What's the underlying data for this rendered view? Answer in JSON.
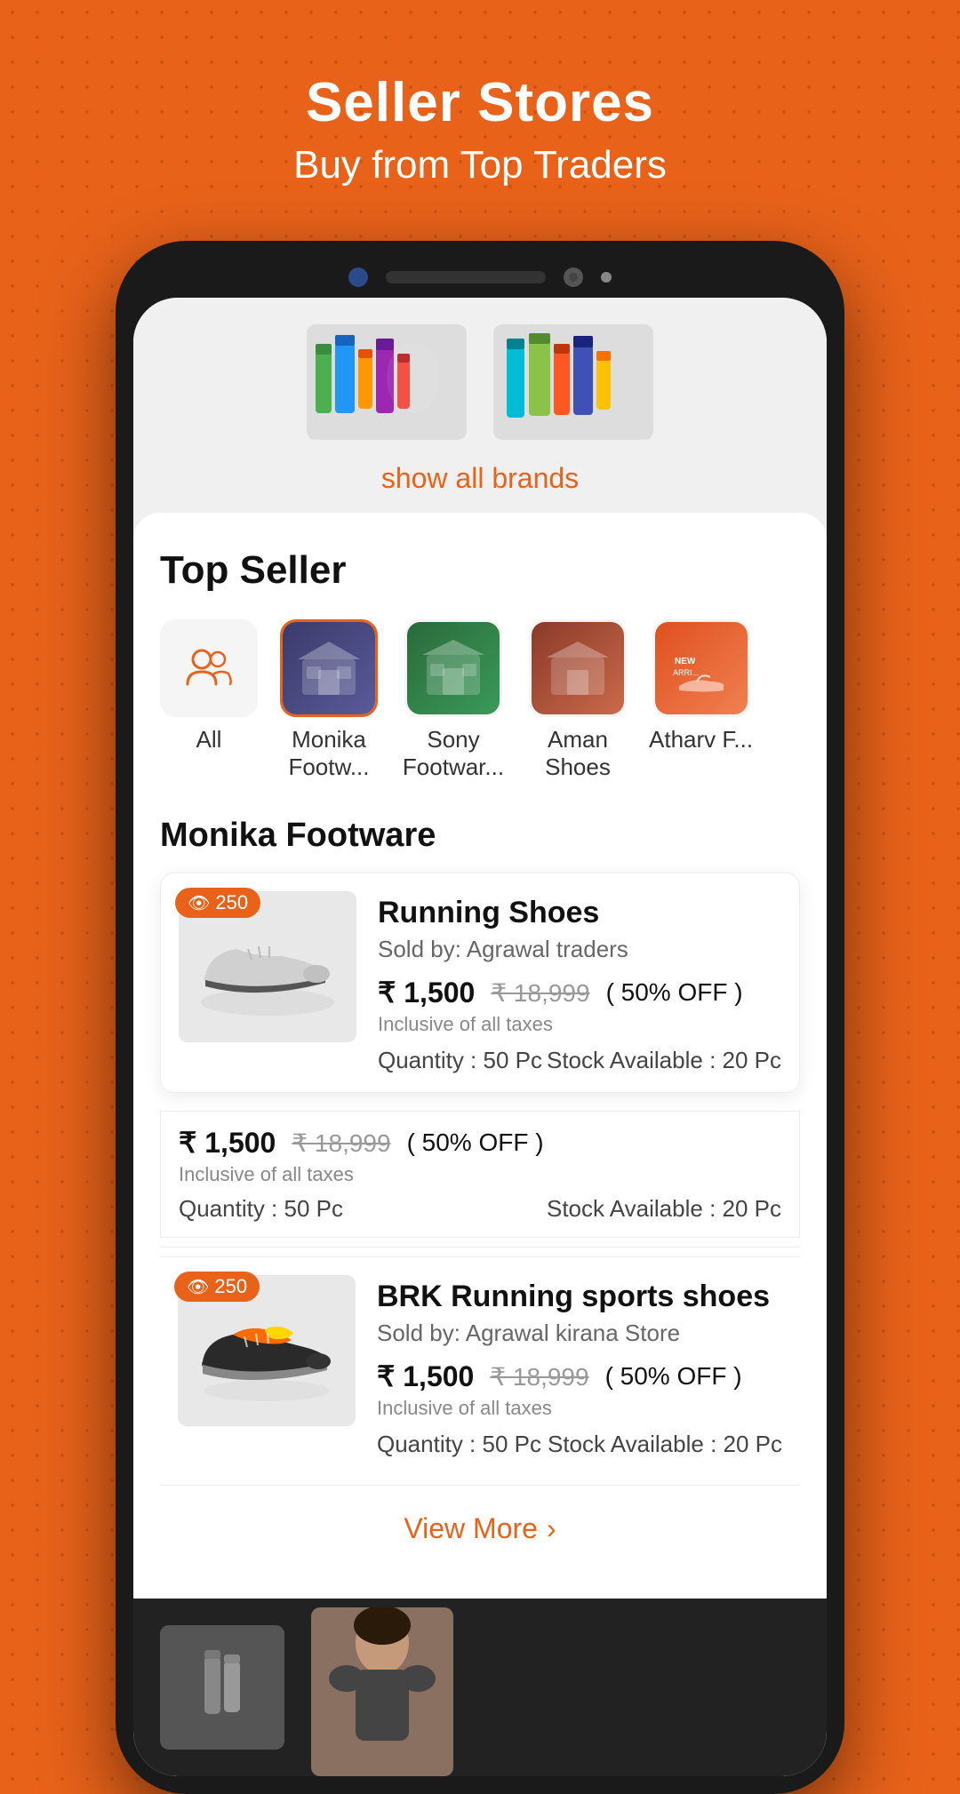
{
  "header": {
    "title": "Seller Stores",
    "subtitle": "Buy from Top Traders"
  },
  "brands": {
    "show_all_label": "show all brands"
  },
  "top_seller": {
    "heading": "Top Seller",
    "tabs": [
      {
        "id": "all",
        "label": "All",
        "type": "icon"
      },
      {
        "id": "monika",
        "label": "Monika Footw...",
        "type": "store",
        "color": "store-monika"
      },
      {
        "id": "sony",
        "label": "Sony Footwar...",
        "type": "store",
        "color": "store-sony"
      },
      {
        "id": "aman",
        "label": "Aman Shoes",
        "type": "store",
        "color": "store-aman"
      },
      {
        "id": "atharv",
        "label": "Atharv F...",
        "type": "store",
        "color": "store-atharv"
      }
    ]
  },
  "active_seller": {
    "name": "Monika Footware"
  },
  "products": [
    {
      "id": 1,
      "name": "Running Shoes",
      "seller": "Sold by: Agrawal traders",
      "views": "250",
      "price_current": "₹ 1,500",
      "price_original": "₹ 18,999",
      "discount": "( 50% OFF )",
      "inclusive": "Inclusive of all taxes",
      "quantity": "Quantity : 50 Pc",
      "stock": "Stock Available : 20 Pc"
    },
    {
      "id": 2,
      "price_current": "₹ 1,500",
      "price_original": "₹ 18,999",
      "discount": "( 50% OFF )",
      "inclusive": "Inclusive of all taxes",
      "quantity": "Quantity : 50 Pc",
      "stock": "Stock Available : 20 Pc"
    },
    {
      "id": 3,
      "name": "BRK Running sports shoes",
      "seller": "Sold by: Agrawal kirana Store",
      "views": "250",
      "price_current": "₹ 1,500",
      "price_original": "₹ 18,999",
      "discount": "( 50% OFF )",
      "inclusive": "Inclusive of all taxes",
      "quantity": "Quantity : 50 Pc",
      "stock": "Stock Available : 20 Pc"
    }
  ],
  "view_more": {
    "label": "View More",
    "arrow": "›"
  },
  "accent_color": "#E8621A"
}
